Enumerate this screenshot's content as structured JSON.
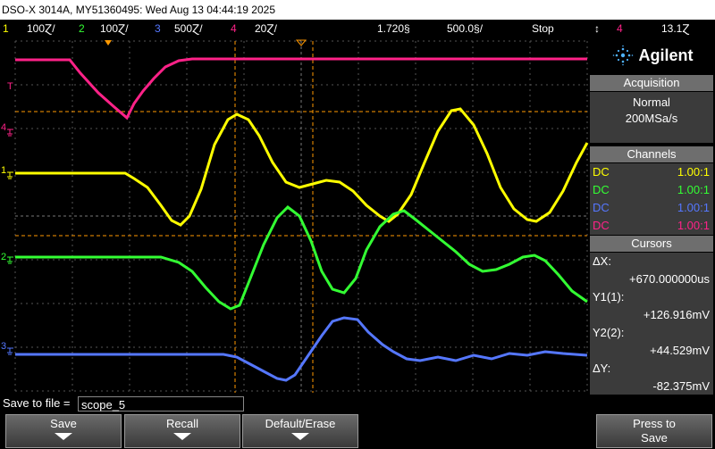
{
  "title": "DSO-X 3014A, MY51360495: Wed Aug 13 04:44:19 2025",
  "status": {
    "ch1_label": "1",
    "ch1_scale": "100Ɀ/",
    "ch2_label": "2",
    "ch2_scale": "100Ɀ/",
    "ch3_label": "3",
    "ch3_scale": "500Ɀ/",
    "ch4_label": "4",
    "ch4_scale": "20Ɀ/",
    "time_delay": "1.720§",
    "time_scale": "500.0§/",
    "run_state": "Stop",
    "trig_arrow": "↕",
    "trig_source": "4",
    "trig_level": "13.1Ɀ"
  },
  "brand": "Agilent",
  "acquisition": {
    "header": "Acquisition",
    "mode": "Normal",
    "rate": "200MSa/s"
  },
  "channels": {
    "header": "Channels",
    "rows": [
      {
        "coupling": "DC",
        "probe": "1.00:1",
        "color": "#ffff00"
      },
      {
        "coupling": "DC",
        "probe": "1.00:1",
        "color": "#33ff33"
      },
      {
        "coupling": "DC",
        "probe": "1.00:1",
        "color": "#5577ff"
      },
      {
        "coupling": "DC",
        "probe": "1.00:1",
        "color": "#ff2288"
      }
    ]
  },
  "cursors": {
    "header": "Cursors",
    "dx_label": "ΔX:",
    "dx_value": "+670.000000us",
    "y1_label": "Y1(1):",
    "y1_value": "+126.916mV",
    "y2_label": "Y2(2):",
    "y2_value": "+44.529mV",
    "dy_label": "ΔY:",
    "dy_value": "-82.375mV"
  },
  "save": {
    "label": "Save to file =",
    "filename": "scope_5"
  },
  "softkeys": {
    "save": "Save",
    "recall": "Recall",
    "default": "Default/Erase",
    "press_to": "Press to",
    "press_save": "Save"
  },
  "trace_markers": {
    "ch1": "1",
    "ch2": "2",
    "ch3": "3",
    "ch4": "4",
    "trig": "T"
  },
  "colors": {
    "ch1": "#ffff00",
    "ch2": "#33ff33",
    "ch3": "#5577ff",
    "ch4": "#ff2288",
    "cursor": "#ff9900"
  }
}
